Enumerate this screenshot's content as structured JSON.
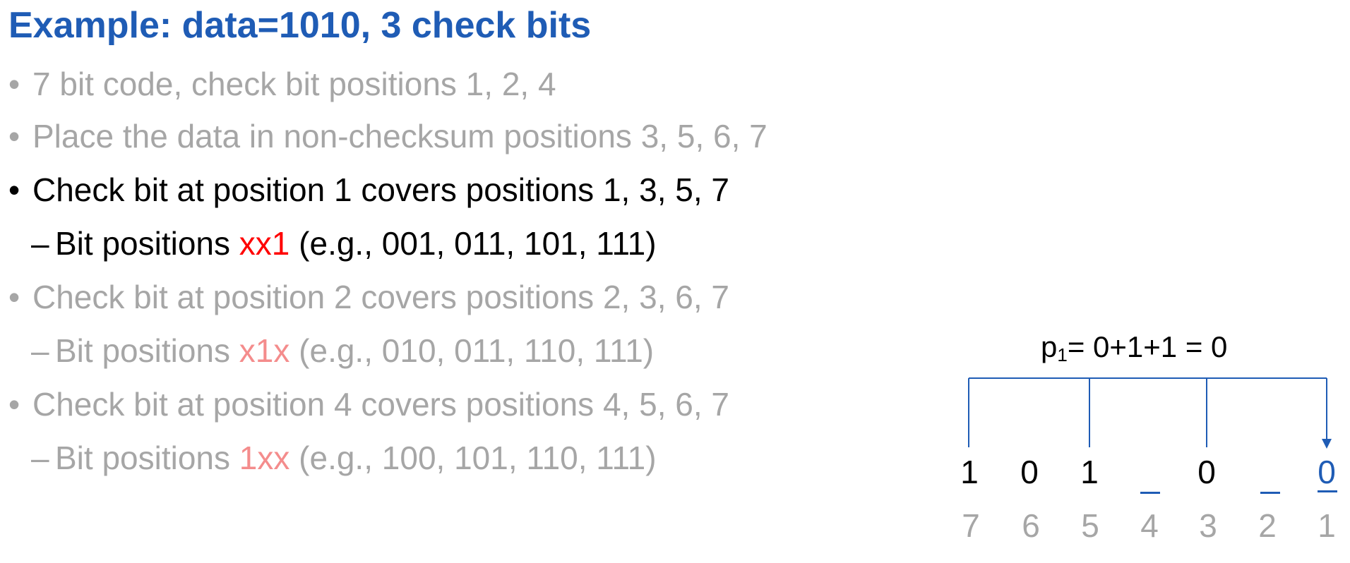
{
  "slide": {
    "title": "Example: data=1010, 3 check bits",
    "bullets": [
      {
        "kind": "bullet",
        "text": "7 bit code, check bit positions 1, 2, 4",
        "active": false
      },
      {
        "kind": "bullet",
        "text": "Place the data in non-checksum positions 3, 5, 6, 7",
        "active": false
      },
      {
        "kind": "bullet",
        "text": "Check bit at position 1 covers positions 1, 3, 5, 7",
        "active": true
      },
      {
        "kind": "sub",
        "pre": "Bit positions ",
        "hl": "xx1",
        "post": " (e.g., 001, 011, 101, 111)",
        "active": true
      },
      {
        "kind": "bullet",
        "text": "Check bit at position 2 covers positions 2, 3, 6, 7",
        "active": false
      },
      {
        "kind": "sub",
        "pre": "Bit positions ",
        "hl": "x1x",
        "post": " (e.g., 010, 011, 110, 111)",
        "active": false
      },
      {
        "kind": "bullet",
        "text": "Check bit at position 4 covers positions 4, 5, 6, 7",
        "active": false
      },
      {
        "kind": "sub",
        "pre": "Bit positions ",
        "hl": "1xx",
        "post": " (e.g., 100, 101, 110, 111)",
        "active": false
      }
    ]
  },
  "diagram": {
    "formula_p": "p",
    "formula_sub": "1",
    "formula_rest": "= 0+1+1 = 0",
    "bits": [
      "1",
      "0",
      "1",
      "_",
      "0",
      "_",
      "0"
    ],
    "positions": [
      "7",
      "6",
      "5",
      "4",
      "3",
      "2",
      "1"
    ],
    "accent": "#1f5cb5"
  }
}
